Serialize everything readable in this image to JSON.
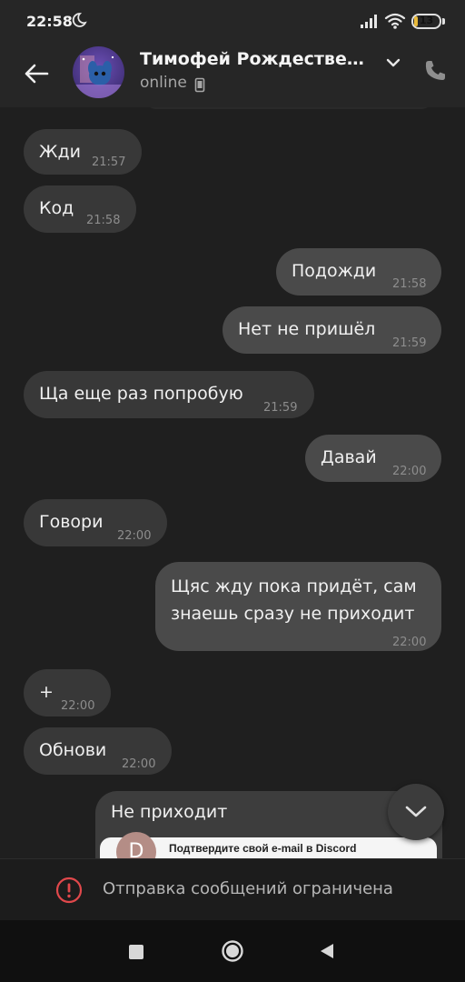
{
  "status_bar": {
    "time": "22:58",
    "battery_level": "13",
    "battery_fraction": 0.13
  },
  "header": {
    "contact_name": "Тимофей Рождествен…",
    "status": "online"
  },
  "messages": [
    {
      "dir": "in",
      "text": "Жди",
      "time": "21:57"
    },
    {
      "dir": "in",
      "text": "Код",
      "time": "21:58"
    },
    {
      "dir": "out",
      "text": "Подожди",
      "time": "21:58"
    },
    {
      "dir": "out",
      "text": "Нет не пришёл",
      "time": "21:59"
    },
    {
      "dir": "in",
      "text": "Ща еще раз попробую",
      "time": "21:59"
    },
    {
      "dir": "out",
      "text": "Давай",
      "time": "22:00"
    },
    {
      "dir": "in",
      "text": "Говори",
      "time": "22:00"
    },
    {
      "dir": "out",
      "text": "Щяс жду пока придёт, сам знаешь сразу не приходит",
      "time": "22:00"
    },
    {
      "dir": "in",
      "text": "+",
      "time": "22:00"
    },
    {
      "dir": "in",
      "text": "Обнови",
      "time": "22:00"
    }
  ],
  "media_message": {
    "text": "Не приходит",
    "preview_avatar_letter": "D",
    "preview_caption": "Подтвердите свой e-mail в Discord"
  },
  "restriction_banner": {
    "text": "Отправка сообщений ограничена"
  },
  "colors": {
    "accent_warning": "#e0484b",
    "incoming_bubble": "#383838",
    "outgoing_bubble": "#4a4a4a"
  }
}
